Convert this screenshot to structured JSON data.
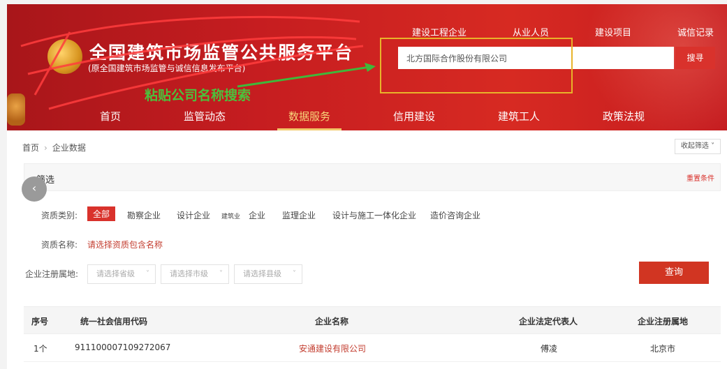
{
  "header": {
    "site_title": "全国建筑市场监管公共服务平台",
    "site_subtitle": "(原全国建筑市场监管与诚信信息发布平台)",
    "top_links": [
      "建设工程企业",
      "从业人员",
      "建设项目",
      "诚信记录"
    ],
    "search": {
      "value": "北方国际合作股份有限公司",
      "button": "搜寻"
    },
    "annotation": "粘贴公司名称搜索",
    "nav": [
      "首页",
      "监管动态",
      "数据服务",
      "信用建设",
      "建筑工人",
      "政策法规"
    ],
    "nav_active": "数据服务"
  },
  "breadcrumb": [
    "首页",
    "企业数据"
  ],
  "collapse_label": "收起筛选",
  "filter": {
    "title": "筛选",
    "reset": "重置条件",
    "qual_type_label": "资质类别:",
    "qual_types": [
      "全部",
      "勘察企业",
      "设计企业",
      "建筑业",
      "企业",
      "监理企业",
      "设计与施工一体化企业",
      "造价咨询企业"
    ],
    "qual_name_label": "资质名称:",
    "qual_name_placeholder": "请选择资质包含名称",
    "region_label": "企业注册属地:",
    "region_selects": [
      "请选择省级",
      "请选择市级",
      "请选择县级"
    ],
    "query": "查询"
  },
  "table": {
    "headers": [
      "序号",
      "统一社会信用代码",
      "企业名称",
      "企业法定代表人",
      "企业注册属地"
    ],
    "rows": [
      {
        "index": "1个",
        "credit_code": "911100007109272067",
        "name": "安通建设有限公司",
        "legal_rep": "傅凌",
        "region": "北京市"
      }
    ]
  },
  "colors": {
    "header_red": "#c61d20",
    "accent_red": "#d9322c",
    "highlight_yellow": "#e8b42a",
    "annotation_green": "#4bc13c",
    "nav_active": "#f8d57a"
  }
}
